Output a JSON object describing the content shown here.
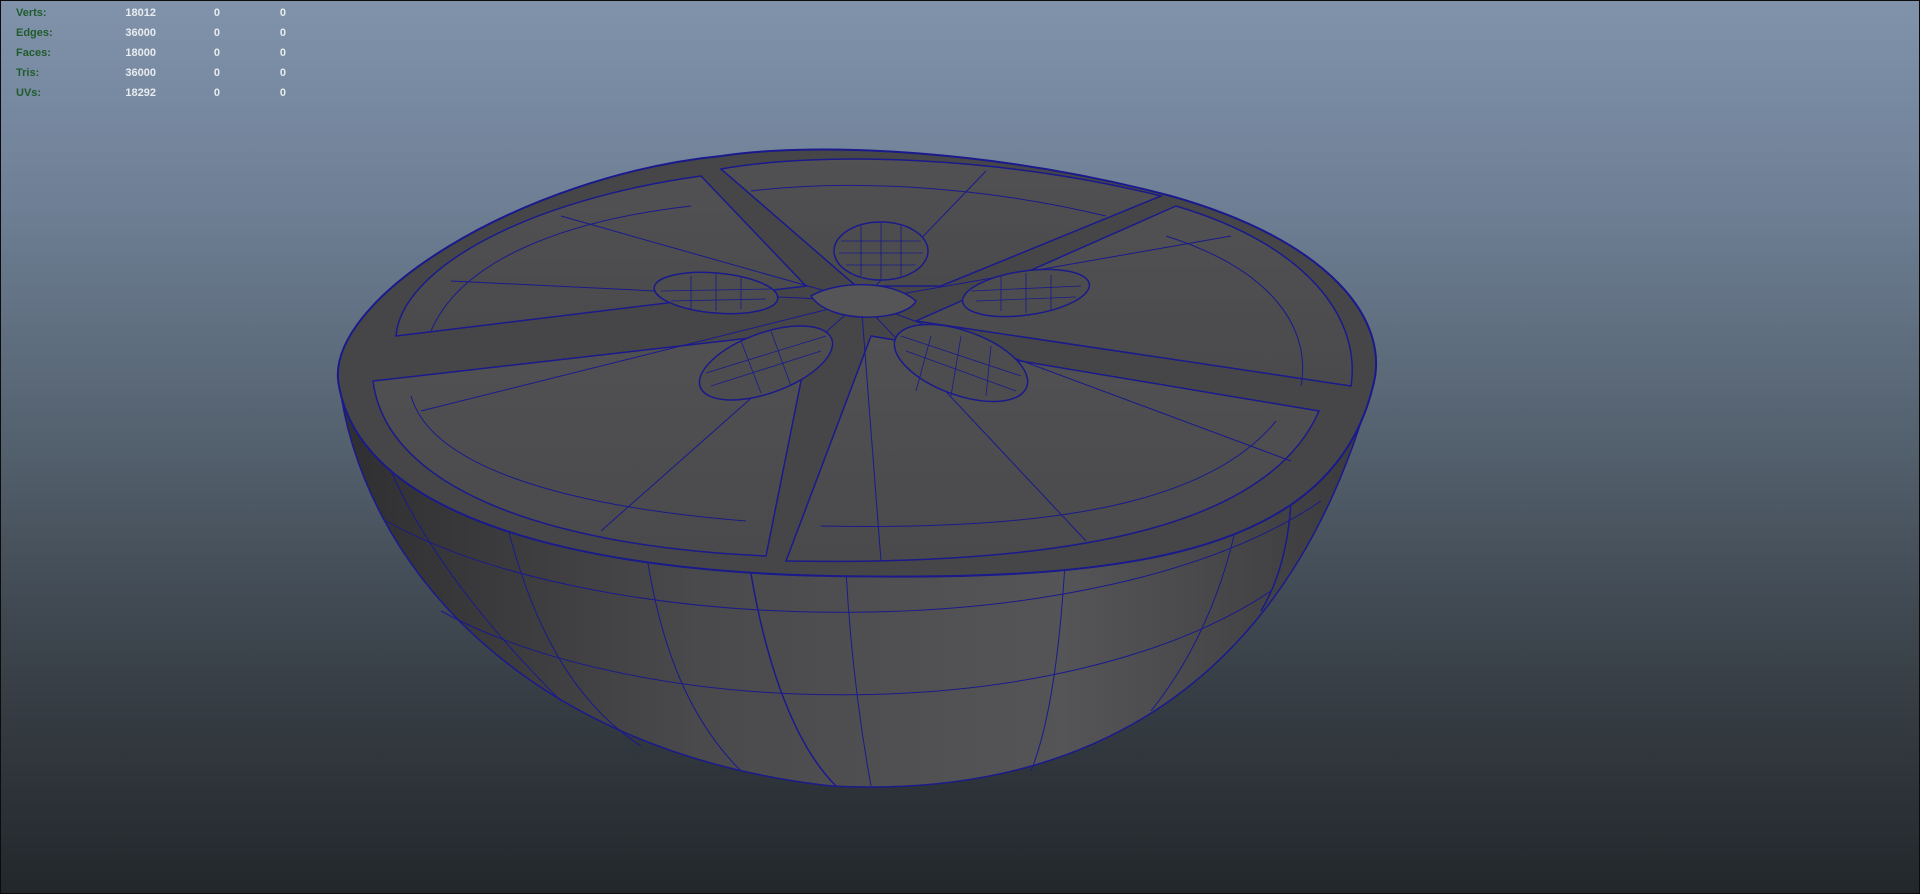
{
  "viewport": {
    "background_top": "#8093ab",
    "background_bottom": "#22272b",
    "mesh_color": "#4c4c4c",
    "wire_color": "#1a1a8c",
    "object": "half orange model (wireframe on shaded)"
  },
  "hud": {
    "rows": [
      {
        "label": "Verts:",
        "total": "18012",
        "selected": "0",
        "component": "0"
      },
      {
        "label": "Edges:",
        "total": "36000",
        "selected": "0",
        "component": "0"
      },
      {
        "label": "Faces:",
        "total": "18000",
        "selected": "0",
        "component": "0"
      },
      {
        "label": "Tris:",
        "total": "36000",
        "selected": "0",
        "component": "0"
      },
      {
        "label": "UVs:",
        "total": "18292",
        "selected": "0",
        "component": "0"
      }
    ]
  }
}
